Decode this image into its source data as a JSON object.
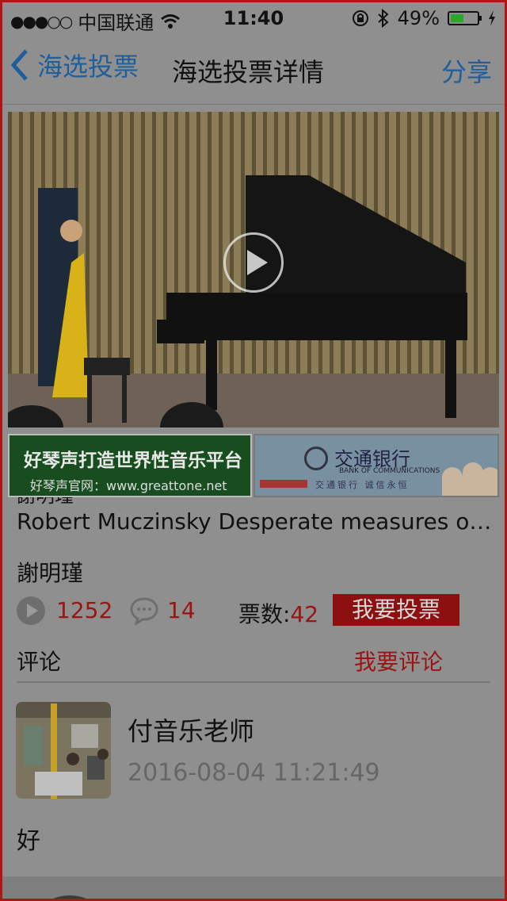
{
  "status_bar": {
    "signal_dots": "●●●○○",
    "carrier": "中国联通",
    "time": "11:40",
    "battery_text": "49%",
    "battery_level": 0.49
  },
  "nav": {
    "back_label": "海选投票",
    "title": "海选投票详情",
    "share_label": "分享"
  },
  "ads": {
    "left_line1": "好琴声打造世界性音乐平台",
    "left_line2": "好琴声官网：www.greattone.net",
    "right_name": "交通银行",
    "right_en": "BANK OF COMMUNICATIONS",
    "right_slogan": "交通银行 诚信永恒"
  },
  "video": {
    "title": "Robert Muczinsky Desperate measures o…",
    "author": "謝明瑾",
    "play_count": "1252",
    "comment_count": "14",
    "votes_label": "票数:",
    "votes_value": "42",
    "vote_button": "我要投票"
  },
  "comments": {
    "header": "评论",
    "add_button": "我要评论",
    "items": [
      {
        "user": "付音乐老师",
        "time": "2016-08-04 11:21:49",
        "text": "好"
      }
    ]
  },
  "colors": {
    "accent_blue": "#1f5e9c",
    "accent_red": "#9b1414",
    "battery_green": "#2aa82a"
  }
}
